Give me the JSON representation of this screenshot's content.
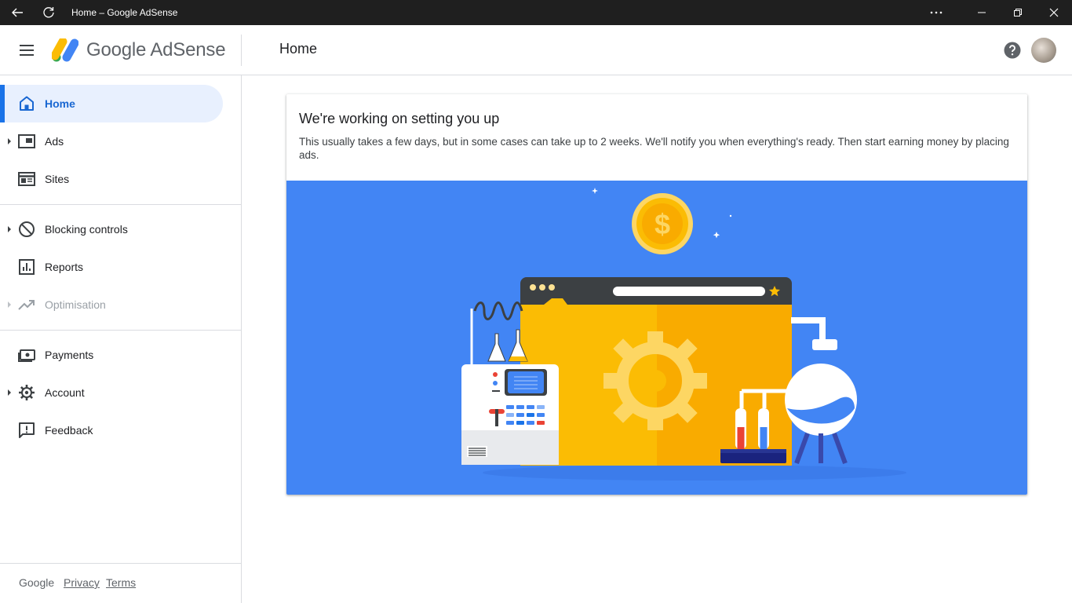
{
  "window": {
    "title": "Home – Google AdSense"
  },
  "header": {
    "brand": "Google AdSense",
    "page_title": "Home"
  },
  "sidebar": {
    "items": [
      {
        "label": "Home",
        "icon": "home-icon",
        "active": true
      },
      {
        "label": "Ads",
        "icon": "ads-icon",
        "expandable": true
      },
      {
        "label": "Sites",
        "icon": "sites-icon"
      },
      {
        "label": "Blocking controls",
        "icon": "block-icon",
        "expandable": true
      },
      {
        "label": "Reports",
        "icon": "reports-icon"
      },
      {
        "label": "Optimisation",
        "icon": "trending-icon",
        "expandable": true,
        "disabled": true
      },
      {
        "label": "Payments",
        "icon": "payments-icon"
      },
      {
        "label": "Account",
        "icon": "gear-icon",
        "expandable": true
      },
      {
        "label": "Feedback",
        "icon": "feedback-icon"
      }
    ],
    "footer": {
      "brand": "Google",
      "privacy": "Privacy",
      "terms": "Terms"
    }
  },
  "card": {
    "title": "We're working on setting you up",
    "description": "This usually takes a few days, but in some cases can take up to 2 weeks. We'll notify you when everything's ready. Then start earning money by placing ads."
  },
  "colors": {
    "accent": "#1a73e8",
    "active_bg": "#e8f0fe",
    "illustration_bg": "#4285f4",
    "browser_yellow": "#fbbc04",
    "browser_orange": "#f9ab00"
  }
}
